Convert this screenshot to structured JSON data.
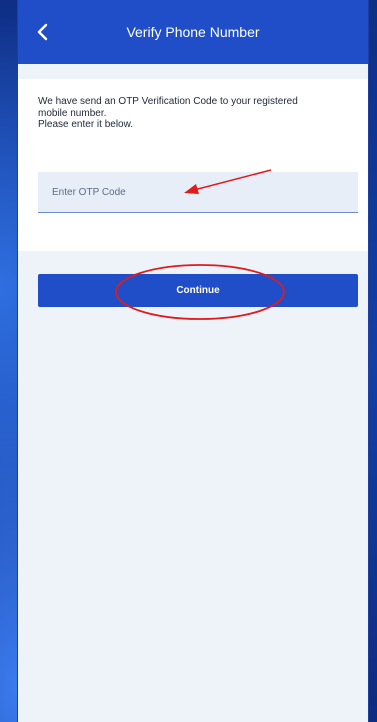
{
  "header": {
    "title": "Verify Phone Number",
    "back_icon": "chevron-left-icon"
  },
  "message": {
    "lines": [
      "We have send an OTP Verification Code to your registered",
      "mobile number.",
      "Please enter it below."
    ]
  },
  "otp": {
    "value": "",
    "placeholder": "Enter OTP Code"
  },
  "actions": {
    "continue_label": "Continue"
  },
  "colors": {
    "header_bg": "#1f4ec8",
    "button_bg": "#1f4ec8",
    "screen_bg": "#eef2f9",
    "annotation": "#e01b1b"
  }
}
